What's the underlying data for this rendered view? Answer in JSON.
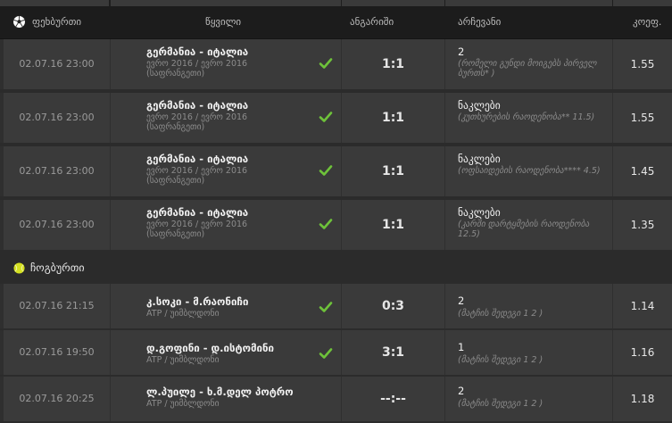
{
  "header": {
    "section": "ფეხბურთი",
    "col_event": "წყვილი",
    "col_score": "ანგარიში",
    "col_pick": "არჩევანი",
    "col_odds": "კოეფ."
  },
  "tennis_section": "ჩოგბურთი",
  "rows": [
    {
      "date": "02.07.16 23:00",
      "title": "გერმანია - იტალია",
      "sub": "ევრო 2016 / ევრო 2016 (საფრანგეთი)",
      "score": "1:1",
      "pick": "2",
      "pick_sub": "(რომელი გუნდი მოიგებს პირველ ბურთს* )",
      "odds": "1.55",
      "checked": true
    },
    {
      "date": "02.07.16 23:00",
      "title": "გერმანია - იტალია",
      "sub": "ევრო 2016 / ევრო 2016 (საფრანგეთი)",
      "score": "1:1",
      "pick": "ნაკლები",
      "pick_sub": "(კუთხურების რაოდენობა** 11.5)",
      "odds": "1.55",
      "checked": true
    },
    {
      "date": "02.07.16 23:00",
      "title": "გერმანია - იტალია",
      "sub": "ევრო 2016 / ევრო 2016 (საფრანგეთი)",
      "score": "1:1",
      "pick": "ნაკლები",
      "pick_sub": "(ოფსაიდების რაოდენობა**** 4.5)",
      "odds": "1.45",
      "checked": true
    },
    {
      "date": "02.07.16 23:00",
      "title": "გერმანია - იტალია",
      "sub": "ევრო 2016 / ევრო 2016 (საფრანგეთი)",
      "score": "1:1",
      "pick": "ნაკლები",
      "pick_sub": "(კარში დარტყმების რაოდენობა 12.5)",
      "odds": "1.35",
      "checked": true
    },
    {
      "date": "02.07.16 21:15",
      "title": "კ.სოკი - მ.რაონიჩი",
      "sub": "ATP / უიმბლდონი",
      "score": "0:3",
      "pick": "2",
      "pick_sub": "(მატჩის შედეგი 1 2 )",
      "odds": "1.14",
      "checked": true
    },
    {
      "date": "02.07.16 19:50",
      "title": "დ.გოფინი - დ.ისტომინი",
      "sub": "ATP / უიმბლდონი",
      "score": "3:1",
      "pick": "1",
      "pick_sub": "(მატჩის შედეგი 1 2 )",
      "odds": "1.16",
      "checked": true
    },
    {
      "date": "02.07.16 20:25",
      "title": "ლ.პუილე - ხ.მ.დელ პოტრო",
      "sub": "ATP / უიმბლდონი",
      "score": "--:--",
      "pick": "2",
      "pick_sub": "(მატჩის შედეგი 1 2 )",
      "odds": "1.18",
      "checked": false
    }
  ],
  "colors": {
    "check": "#6ec23a",
    "tennis_ball": "#d4e021"
  }
}
